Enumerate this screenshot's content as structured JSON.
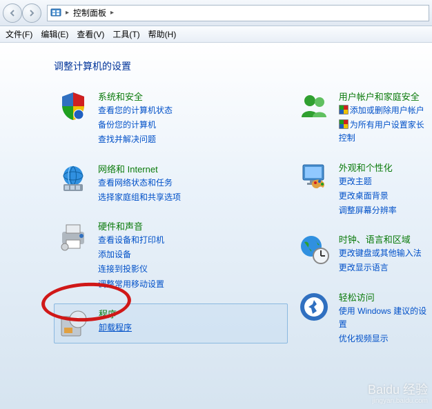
{
  "nav": {
    "breadcrumb": "控制面板"
  },
  "menu": {
    "file": "文件(F)",
    "edit": "编辑(E)",
    "view": "查看(V)",
    "tools": "工具(T)",
    "help": "帮助(H)"
  },
  "page": {
    "title": "调整计算机的设置"
  },
  "categories": {
    "system": {
      "title": "系统和安全",
      "links": [
        "查看您的计算机状态",
        "备份您的计算机",
        "查找并解决问题"
      ]
    },
    "network": {
      "title": "网络和 Internet",
      "links": [
        "查看网络状态和任务",
        "选择家庭组和共享选项"
      ]
    },
    "hardware": {
      "title": "硬件和声音",
      "links": [
        "查看设备和打印机",
        "添加设备",
        "连接到投影仪",
        "调整常用移动设置"
      ]
    },
    "programs": {
      "title": "程序",
      "links": [
        "卸载程序"
      ]
    },
    "users": {
      "title": "用户帐户和家庭安全",
      "links": [
        "添加或删除用户帐户",
        "为所有用户设置家长控制"
      ]
    },
    "appearance": {
      "title": "外观和个性化",
      "links": [
        "更改主题",
        "更改桌面背景",
        "调整屏幕分辨率"
      ]
    },
    "clock": {
      "title": "时钟、语言和区域",
      "links": [
        "更改键盘或其他输入法",
        "更改显示语言"
      ]
    },
    "ease": {
      "title": "轻松访问",
      "links": [
        "使用 Windows 建议的设置",
        "优化视频显示"
      ]
    }
  },
  "watermark": {
    "main": "Baidu 经验",
    "sub": "jingyan.baidu.com"
  }
}
